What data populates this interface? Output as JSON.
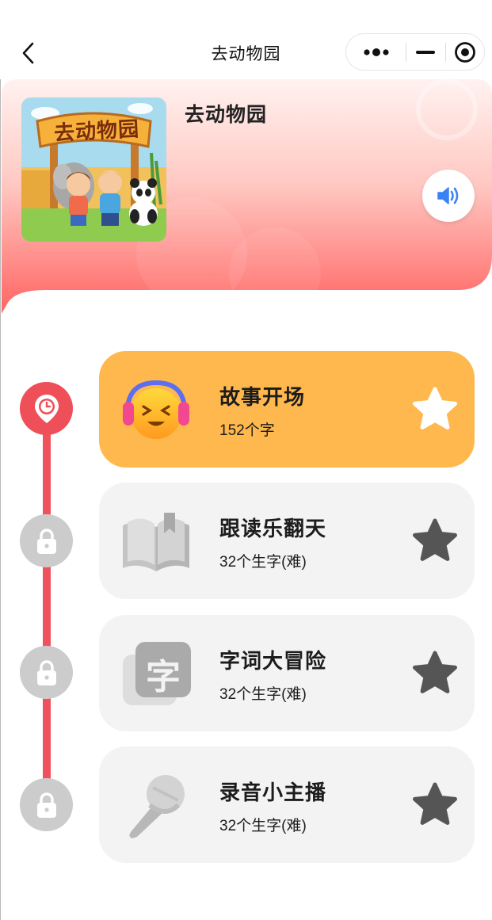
{
  "header": {
    "title": "去动物园",
    "back_icon": "chevron-left-icon",
    "capsule": {
      "more_icon": "more-dots-icon",
      "minimize_icon": "minimize-icon",
      "close_icon": "target-close-icon"
    }
  },
  "banner": {
    "title": "去动物园",
    "cover_sign_text": "去动物园",
    "sound_icon": "speaker-icon",
    "gradient_top": "#fff0ee",
    "gradient_bottom": "#ff6b67"
  },
  "colors": {
    "active_card": "#ffb84e",
    "locked_card": "#f3f3f3",
    "timeline": "#f0525d",
    "active_node": "#ee4f58",
    "locked_node": "#cccccc",
    "locked_star": "#555555",
    "sound_icon": "#3b82f6"
  },
  "activities": [
    {
      "title": "故事开场",
      "subtitle": "152个字",
      "state": "active",
      "icon": "headphones-emoji-icon",
      "node_icon": "clock-pin-icon",
      "star_icon": "star-icon-white"
    },
    {
      "title": "跟读乐翻天",
      "subtitle": "32个生字(难)",
      "state": "locked",
      "icon": "open-book-icon",
      "node_icon": "lock-icon",
      "star_icon": "star-icon-gray"
    },
    {
      "title": "字词大冒险",
      "subtitle": "32个生字(难)",
      "state": "locked",
      "icon": "character-card-icon",
      "icon_char": "字",
      "node_icon": "lock-icon",
      "star_icon": "star-icon-gray"
    },
    {
      "title": "录音小主播",
      "subtitle": "32个生字(难)",
      "state": "locked",
      "icon": "microphone-icon",
      "node_icon": "lock-icon",
      "star_icon": "star-icon-gray"
    }
  ]
}
